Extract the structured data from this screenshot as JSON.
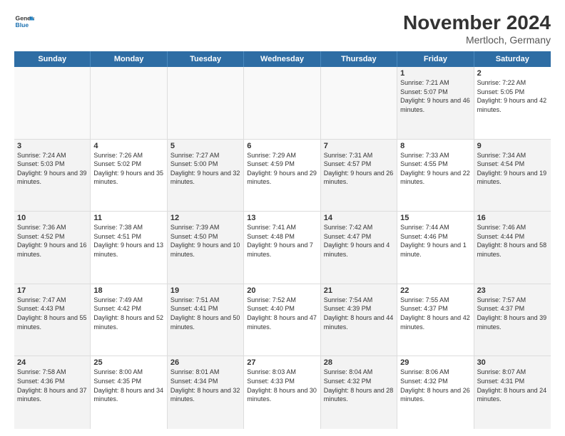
{
  "header": {
    "logo_general": "General",
    "logo_blue": "Blue",
    "month_title": "November 2024",
    "location": "Mertloch, Germany"
  },
  "calendar": {
    "headers": [
      "Sunday",
      "Monday",
      "Tuesday",
      "Wednesday",
      "Thursday",
      "Friday",
      "Saturday"
    ],
    "rows": [
      [
        {
          "day": "",
          "text": "",
          "empty": true
        },
        {
          "day": "",
          "text": "",
          "empty": true
        },
        {
          "day": "",
          "text": "",
          "empty": true
        },
        {
          "day": "",
          "text": "",
          "empty": true
        },
        {
          "day": "",
          "text": "",
          "empty": true
        },
        {
          "day": "1",
          "text": "Sunrise: 7:21 AM\nSunset: 5:07 PM\nDaylight: 9 hours and 46 minutes.",
          "shaded": true
        },
        {
          "day": "2",
          "text": "Sunrise: 7:22 AM\nSunset: 5:05 PM\nDaylight: 9 hours and 42 minutes.",
          "shaded": false
        }
      ],
      [
        {
          "day": "3",
          "text": "Sunrise: 7:24 AM\nSunset: 5:03 PM\nDaylight: 9 hours and 39 minutes.",
          "shaded": true
        },
        {
          "day": "4",
          "text": "Sunrise: 7:26 AM\nSunset: 5:02 PM\nDaylight: 9 hours and 35 minutes.",
          "shaded": false
        },
        {
          "day": "5",
          "text": "Sunrise: 7:27 AM\nSunset: 5:00 PM\nDaylight: 9 hours and 32 minutes.",
          "shaded": true
        },
        {
          "day": "6",
          "text": "Sunrise: 7:29 AM\nSunset: 4:59 PM\nDaylight: 9 hours and 29 minutes.",
          "shaded": false
        },
        {
          "day": "7",
          "text": "Sunrise: 7:31 AM\nSunset: 4:57 PM\nDaylight: 9 hours and 26 minutes.",
          "shaded": true
        },
        {
          "day": "8",
          "text": "Sunrise: 7:33 AM\nSunset: 4:55 PM\nDaylight: 9 hours and 22 minutes.",
          "shaded": false
        },
        {
          "day": "9",
          "text": "Sunrise: 7:34 AM\nSunset: 4:54 PM\nDaylight: 9 hours and 19 minutes.",
          "shaded": true
        }
      ],
      [
        {
          "day": "10",
          "text": "Sunrise: 7:36 AM\nSunset: 4:52 PM\nDaylight: 9 hours and 16 minutes.",
          "shaded": true
        },
        {
          "day": "11",
          "text": "Sunrise: 7:38 AM\nSunset: 4:51 PM\nDaylight: 9 hours and 13 minutes.",
          "shaded": false
        },
        {
          "day": "12",
          "text": "Sunrise: 7:39 AM\nSunset: 4:50 PM\nDaylight: 9 hours and 10 minutes.",
          "shaded": true
        },
        {
          "day": "13",
          "text": "Sunrise: 7:41 AM\nSunset: 4:48 PM\nDaylight: 9 hours and 7 minutes.",
          "shaded": false
        },
        {
          "day": "14",
          "text": "Sunrise: 7:42 AM\nSunset: 4:47 PM\nDaylight: 9 hours and 4 minutes.",
          "shaded": true
        },
        {
          "day": "15",
          "text": "Sunrise: 7:44 AM\nSunset: 4:46 PM\nDaylight: 9 hours and 1 minute.",
          "shaded": false
        },
        {
          "day": "16",
          "text": "Sunrise: 7:46 AM\nSunset: 4:44 PM\nDaylight: 8 hours and 58 minutes.",
          "shaded": true
        }
      ],
      [
        {
          "day": "17",
          "text": "Sunrise: 7:47 AM\nSunset: 4:43 PM\nDaylight: 8 hours and 55 minutes.",
          "shaded": true
        },
        {
          "day": "18",
          "text": "Sunrise: 7:49 AM\nSunset: 4:42 PM\nDaylight: 8 hours and 52 minutes.",
          "shaded": false
        },
        {
          "day": "19",
          "text": "Sunrise: 7:51 AM\nSunset: 4:41 PM\nDaylight: 8 hours and 50 minutes.",
          "shaded": true
        },
        {
          "day": "20",
          "text": "Sunrise: 7:52 AM\nSunset: 4:40 PM\nDaylight: 8 hours and 47 minutes.",
          "shaded": false
        },
        {
          "day": "21",
          "text": "Sunrise: 7:54 AM\nSunset: 4:39 PM\nDaylight: 8 hours and 44 minutes.",
          "shaded": true
        },
        {
          "day": "22",
          "text": "Sunrise: 7:55 AM\nSunset: 4:37 PM\nDaylight: 8 hours and 42 minutes.",
          "shaded": false
        },
        {
          "day": "23",
          "text": "Sunrise: 7:57 AM\nSunset: 4:37 PM\nDaylight: 8 hours and 39 minutes.",
          "shaded": true
        }
      ],
      [
        {
          "day": "24",
          "text": "Sunrise: 7:58 AM\nSunset: 4:36 PM\nDaylight: 8 hours and 37 minutes.",
          "shaded": true
        },
        {
          "day": "25",
          "text": "Sunrise: 8:00 AM\nSunset: 4:35 PM\nDaylight: 8 hours and 34 minutes.",
          "shaded": false
        },
        {
          "day": "26",
          "text": "Sunrise: 8:01 AM\nSunset: 4:34 PM\nDaylight: 8 hours and 32 minutes.",
          "shaded": true
        },
        {
          "day": "27",
          "text": "Sunrise: 8:03 AM\nSunset: 4:33 PM\nDaylight: 8 hours and 30 minutes.",
          "shaded": false
        },
        {
          "day": "28",
          "text": "Sunrise: 8:04 AM\nSunset: 4:32 PM\nDaylight: 8 hours and 28 minutes.",
          "shaded": true
        },
        {
          "day": "29",
          "text": "Sunrise: 8:06 AM\nSunset: 4:32 PM\nDaylight: 8 hours and 26 minutes.",
          "shaded": false
        },
        {
          "day": "30",
          "text": "Sunrise: 8:07 AM\nSunset: 4:31 PM\nDaylight: 8 hours and 24 minutes.",
          "shaded": true
        }
      ]
    ]
  }
}
